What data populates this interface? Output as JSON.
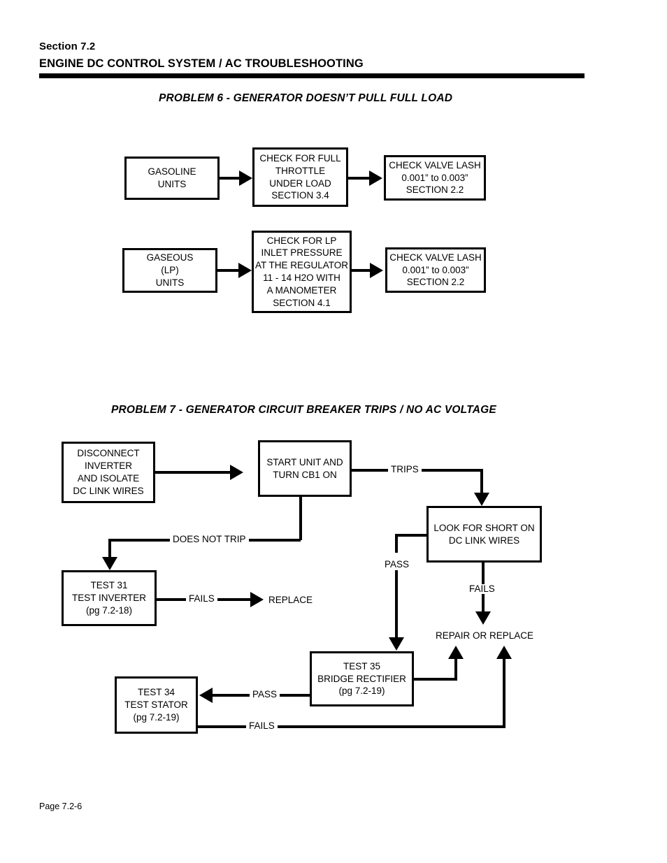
{
  "header": {
    "section": "Section 7.2",
    "title": "ENGINE DC CONTROL SYSTEM / AC TROUBLESHOOTING"
  },
  "footer": {
    "page": "Page 7.2-6"
  },
  "colors": {
    "ink": "#000000",
    "paper": "#ffffff"
  },
  "problem6": {
    "title": "PROBLEM 6 - GENERATOR DOESN’T PULL FULL LOAD",
    "boxes": [
      {
        "id": "gasoline-units",
        "lines": [
          "GASOLINE",
          "UNITS"
        ]
      },
      {
        "id": "check-full-throttle",
        "lines": [
          "CHECK FOR FULL",
          "THROTTLE",
          "UNDER LOAD",
          "SECTION 3.4"
        ]
      },
      {
        "id": "check-valve-lash-gas",
        "lines": [
          "CHECK VALVE LASH",
          "0.001” to 0.003”",
          "SECTION 2.2"
        ]
      },
      {
        "id": "gaseous-lp-units",
        "lines": [
          "GASEOUS",
          "(LP)",
          "UNITS"
        ]
      },
      {
        "id": "check-lp-inlet-pressure",
        "lines": [
          "CHECK FOR LP",
          "INLET PRESSURE",
          "AT THE REGULATOR",
          "11 - 14 H2O WITH",
          "A MANOMETER",
          "SECTION 4.1"
        ]
      },
      {
        "id": "check-valve-lash-lp",
        "lines": [
          "CHECK VALVE LASH",
          "0.001” to 0.003”",
          "SECTION 2.2"
        ]
      }
    ]
  },
  "problem7": {
    "title": "PROBLEM 7 - GENERATOR CIRCUIT BREAKER TRIPS / NO AC VOLTAGE",
    "boxes": [
      {
        "id": "disconnect-inverter",
        "lines": [
          "DISCONNECT",
          "INVERTER",
          "AND ISOLATE",
          "DC LINK WIRES"
        ]
      },
      {
        "id": "start-unit-cb1",
        "lines": [
          "START UNIT AND",
          "TURN CB1 ON"
        ]
      },
      {
        "id": "look-for-short",
        "lines": [
          "LOOK FOR SHORT ON",
          "DC LINK WIRES"
        ]
      },
      {
        "id": "test-31-inverter",
        "lines": [
          "TEST 31",
          "TEST INVERTER",
          "(pg 7.2-18)"
        ]
      },
      {
        "id": "test-35-bridge-rectifier",
        "lines": [
          "TEST 35",
          "BRIDGE RECTIFIER",
          "(pg 7.2-19)"
        ]
      },
      {
        "id": "test-34-stator",
        "lines": [
          "TEST 34",
          "TEST STATOR",
          "(pg 7.2-19)"
        ]
      }
    ],
    "edge_labels": {
      "trips": "TRIPS",
      "does_not_trip": "DOES NOT TRIP",
      "pass_short": "PASS",
      "fails_short": "FAILS",
      "fails_inverter": "FAILS",
      "pass_rectifier": "PASS",
      "fails_stator": "FAILS"
    },
    "terminals": {
      "replace": "REPLACE",
      "repair_or_replace": "REPAIR OR REPLACE"
    }
  },
  "chart_data": {
    "type": "diagram",
    "title": "Generator AC troubleshooting flowcharts",
    "flowcharts": [
      {
        "name": "PROBLEM 6 - GENERATOR DOESN’T PULL FULL LOAD",
        "nodes": [
          "GASOLINE UNITS",
          "CHECK FOR FULL THROTTLE UNDER LOAD SECTION 3.4",
          "CHECK VALVE LASH 0.001” to 0.003” SECTION 2.2",
          "GASEOUS (LP) UNITS",
          "CHECK FOR LP INLET PRESSURE AT THE REGULATOR 11 - 14 H2O WITH A MANOMETER SECTION 4.1",
          "CHECK VALVE LASH 0.001” to 0.003” SECTION 2.2"
        ],
        "edges": [
          {
            "from": "GASOLINE UNITS",
            "to": "CHECK FOR FULL THROTTLE UNDER LOAD SECTION 3.4",
            "label": ""
          },
          {
            "from": "CHECK FOR FULL THROTTLE UNDER LOAD SECTION 3.4",
            "to": "CHECK VALVE LASH 0.001” to 0.003” SECTION 2.2",
            "label": ""
          },
          {
            "from": "GASEOUS (LP) UNITS",
            "to": "CHECK FOR LP INLET PRESSURE AT THE REGULATOR 11 - 14 H2O WITH A MANOMETER SECTION 4.1",
            "label": ""
          },
          {
            "from": "CHECK FOR LP INLET PRESSURE AT THE REGULATOR 11 - 14 H2O WITH A MANOMETER SECTION 4.1",
            "to": "CHECK VALVE LASH 0.001” to 0.003” SECTION 2.2",
            "label": ""
          }
        ]
      },
      {
        "name": "PROBLEM 7 - GENERATOR CIRCUIT BREAKER TRIPS / NO AC VOLTAGE",
        "nodes": [
          "DISCONNECT INVERTER AND ISOLATE DC LINK WIRES",
          "START UNIT AND TURN CB1 ON",
          "LOOK FOR SHORT ON DC LINK WIRES",
          "TEST 31 TEST INVERTER (pg 7.2-18)",
          "TEST 35 BRIDGE RECTIFIER (pg 7.2-19)",
          "TEST 34 TEST STATOR (pg 7.2-19)",
          "REPLACE",
          "REPAIR OR REPLACE"
        ],
        "edges": [
          {
            "from": "DISCONNECT INVERTER AND ISOLATE DC LINK WIRES",
            "to": "START UNIT AND TURN CB1 ON",
            "label": ""
          },
          {
            "from": "START UNIT AND TURN CB1 ON",
            "to": "LOOK FOR SHORT ON DC LINK WIRES",
            "label": "TRIPS"
          },
          {
            "from": "START UNIT AND TURN CB1 ON",
            "to": "TEST 31 TEST INVERTER (pg 7.2-18)",
            "label": "DOES NOT TRIP"
          },
          {
            "from": "TEST 31 TEST INVERTER (pg 7.2-18)",
            "to": "REPLACE",
            "label": "FAILS"
          },
          {
            "from": "LOOK FOR SHORT ON DC LINK WIRES",
            "to": "TEST 35 BRIDGE RECTIFIER (pg 7.2-19)",
            "label": "PASS"
          },
          {
            "from": "LOOK FOR SHORT ON DC LINK WIRES",
            "to": "REPAIR OR REPLACE",
            "label": "FAILS"
          },
          {
            "from": "TEST 35 BRIDGE RECTIFIER (pg 7.2-19)",
            "to": "TEST 34 TEST STATOR (pg 7.2-19)",
            "label": "PASS"
          },
          {
            "from": "TEST 35 BRIDGE RECTIFIER (pg 7.2-19)",
            "to": "REPAIR OR REPLACE",
            "label": ""
          },
          {
            "from": "TEST 34 TEST STATOR (pg 7.2-19)",
            "to": "REPAIR OR REPLACE",
            "label": "FAILS"
          }
        ]
      }
    ]
  }
}
